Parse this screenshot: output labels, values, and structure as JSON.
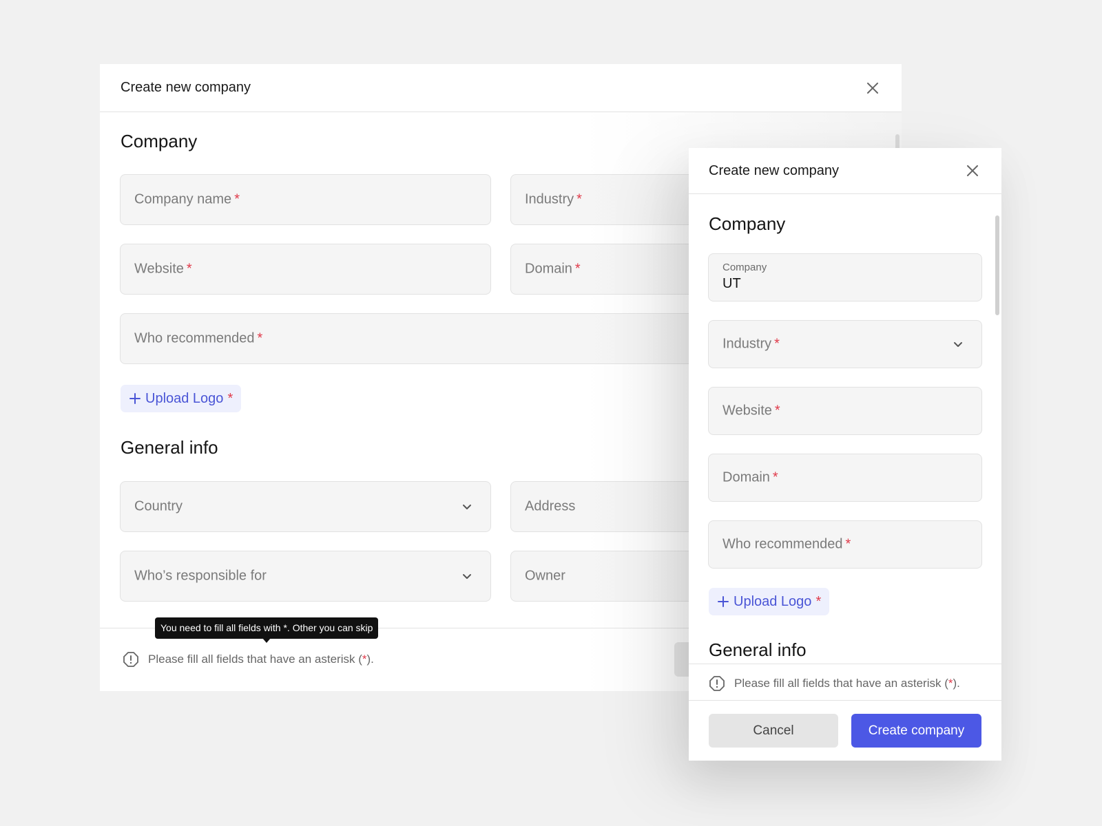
{
  "colors": {
    "background": "#f1f1f1",
    "accent": "#4c58e5",
    "required": "#e03a4a",
    "tooltip_bg": "#111111"
  },
  "left_modal": {
    "title": "Create new company",
    "close_icon": "close-icon",
    "sections": {
      "company_title": "Company",
      "general_title": "General info"
    },
    "fields": {
      "company_name": {
        "placeholder": "Company name",
        "required": "*"
      },
      "industry": {
        "placeholder": "Industry",
        "required": "*"
      },
      "website": {
        "placeholder": "Website",
        "required": "*"
      },
      "domain": {
        "placeholder": "Domain",
        "required": "*"
      },
      "who_recommended": {
        "placeholder": "Who recommended",
        "required": "*"
      },
      "country": {
        "placeholder": "Country",
        "icon": "chevron-down-icon"
      },
      "address": {
        "placeholder": "Address"
      },
      "responsible": {
        "placeholder": "Who’s responsible for",
        "icon": "chevron-down-icon"
      },
      "owner": {
        "placeholder": "Owner"
      }
    },
    "upload_logo": {
      "icon": "plus-icon",
      "label": "Upload Logo",
      "required": "*"
    },
    "tooltip": "You need to fill all fields with *. Other you can skip",
    "notice": {
      "icon": "warning-icon",
      "text_before": "Please fill all fields that have an asterisk (",
      "asterisk": "*",
      "text_after": ")."
    }
  },
  "right_modal": {
    "title": "Create new company",
    "close_icon": "close-icon",
    "sections": {
      "company_title": "Company",
      "general_title": "General info"
    },
    "fields": {
      "company": {
        "label": "Company",
        "value": "UT"
      },
      "industry": {
        "placeholder": "Industry",
        "required": "*",
        "icon": "chevron-down-icon"
      },
      "website": {
        "placeholder": "Website",
        "required": "*"
      },
      "domain": {
        "placeholder": "Domain",
        "required": "*"
      },
      "who_recommended": {
        "placeholder": "Who recommended",
        "required": "*"
      }
    },
    "upload_logo": {
      "icon": "plus-icon",
      "label": "Upload Logo",
      "required": "*"
    },
    "notice": {
      "icon": "warning-icon",
      "text_before": "Please fill all fields that have an asterisk (",
      "asterisk": "*",
      "text_after": ")."
    },
    "buttons": {
      "cancel": "Cancel",
      "create": "Create company"
    }
  }
}
